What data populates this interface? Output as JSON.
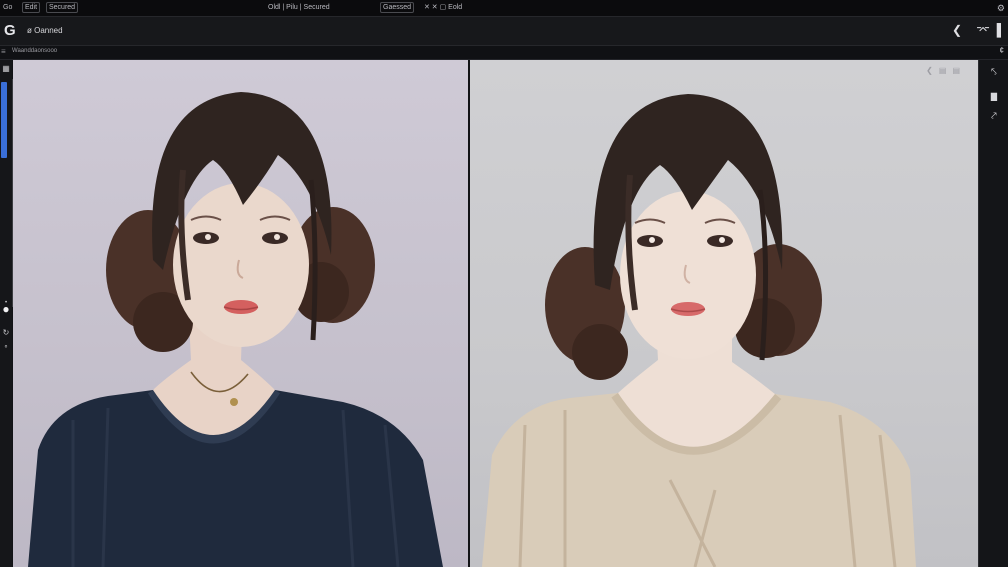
{
  "menubar": {
    "items": [
      "Go",
      "Edit",
      "Secured",
      "Oldl | Pilu | Secured",
      "Gaessed",
      "✕ ✕ ▢ Eold"
    ]
  },
  "toolbar": {
    "logo": "G",
    "title": "ø Oanned",
    "icons": [
      "share-icon",
      "window-icon",
      "menu-icon"
    ]
  },
  "breadcrumb": {
    "text": "Waanddaonsooo",
    "right_glyph": "¢"
  },
  "left_tools": [
    "grid-icon",
    "dot-icon",
    "circle-icon",
    "refresh-icon",
    "settings-icon"
  ],
  "canvas_a": {
    "label": ""
  },
  "canvas_b": {
    "icons": [
      "expand-icon",
      "frame-icon",
      "layers-icon"
    ]
  },
  "right_tools": [
    "pen-icon",
    "brush-icon",
    "line-icon"
  ],
  "colors": {
    "accent": "#3a6fd8",
    "sweater_a": "#1f2a3d",
    "sweater_b": "#d9ccb9",
    "hair": "#3a2a24"
  }
}
